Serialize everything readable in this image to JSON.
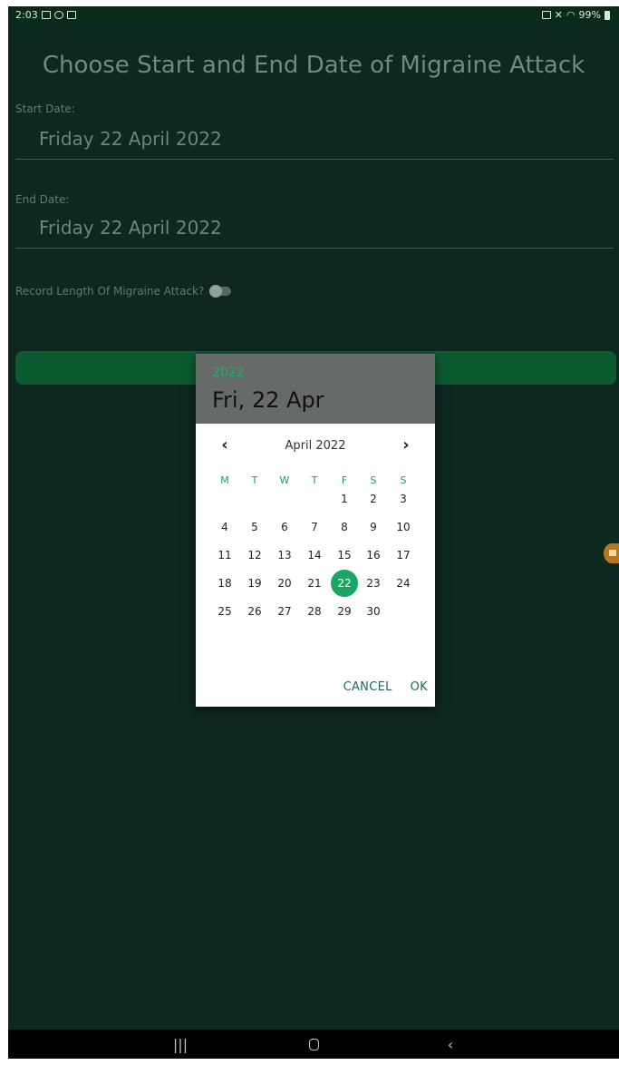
{
  "status_bar": {
    "time": "2:03",
    "battery": "99%"
  },
  "app": {
    "title": "Choose Start and End Date of Migraine Attack",
    "start_label": "Start Date:",
    "start_value": "Friday 22 April 2022",
    "end_label": "End Date:",
    "end_value": "Friday 22 April 2022",
    "toggle_label": "Record Length Of Migraine Attack?",
    "toggle_on": false
  },
  "dialog": {
    "year": "2022",
    "selected_date": "Fri, 22 Apr",
    "month_label": "April 2022",
    "weekdays": [
      "M",
      "T",
      "W",
      "T",
      "F",
      "S",
      "S"
    ],
    "first_weekday_index": 4,
    "days_in_month": 30,
    "selected_day": 22,
    "cancel_label": "CANCEL",
    "ok_label": "OK"
  },
  "colors": {
    "accent": "#16a862",
    "background": "#0d2820",
    "button": "#0c5a2f"
  },
  "icons": {
    "prev": "chevron-left-icon",
    "next": "chevron-right-icon",
    "nav_recents": "recents-icon",
    "nav_home": "home-icon",
    "nav_back": "back-icon"
  }
}
